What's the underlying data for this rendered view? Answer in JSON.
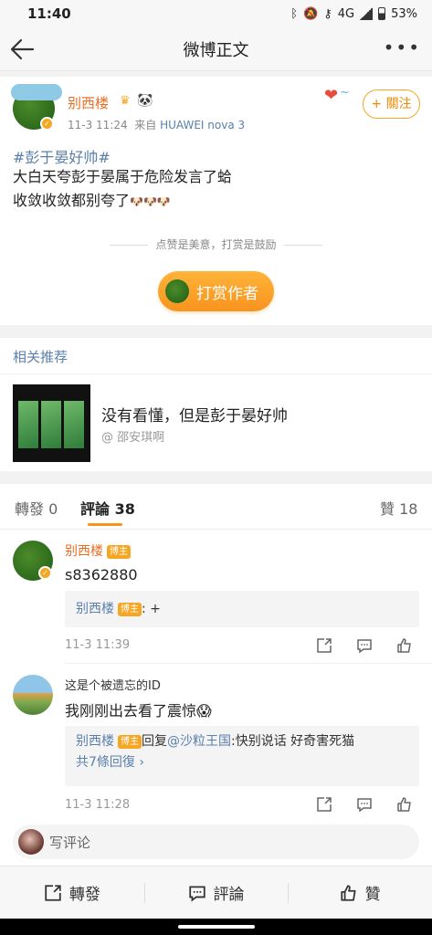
{
  "status_bar": {
    "time": "11:40",
    "network": "4G",
    "battery": "53%"
  },
  "nav": {
    "title": "微博正文"
  },
  "post": {
    "user": "别西楼",
    "time": "11-3 11:24",
    "source_prefix": "来自",
    "device": "HUAWEI nova 3",
    "follow_label": "+ 關注",
    "hashtag": "#彭于晏好帅#",
    "body_line1": "大白天夸彭于晏属于危险发言了蛤",
    "body_line2": "收敛收敛都别夸了",
    "reward_caption": "点赞是美意，打赏是鼓励",
    "reward_button": "打赏作者"
  },
  "related": {
    "title": "相关推荐",
    "item_text": "没有看懂，但是彭于晏好帅",
    "item_author": "@ 邵安琪啊"
  },
  "tabs": {
    "repost": "轉發 0",
    "comments": "評論 38",
    "likes": "贊 18"
  },
  "comments": [
    {
      "user": "别西楼",
      "badge": "博主",
      "text": "s8362880",
      "reply_user": "别西楼",
      "reply_badge": "博主",
      "reply_text": ": +",
      "time": "11-3 11:39"
    },
    {
      "user": "这是个被遗忘的ID",
      "text": "我刚刚出去看了震惊😱",
      "reply_user": "别西楼",
      "reply_badge": "博主",
      "reply_action": "回复",
      "reply_mention": "@沙粒王国",
      "reply_text": ":快别说话 好奇害死猫",
      "reply_more": "共7條回復 ›",
      "time": "11-3 11:28"
    }
  ],
  "write_comment": {
    "placeholder": "写评论"
  },
  "bottom_bar": {
    "repost": "轉發",
    "comment": "評論",
    "like": "贊"
  },
  "colors": {
    "accent": "#f7931e",
    "link": "#5a7fab",
    "username": "#e86b1f"
  }
}
